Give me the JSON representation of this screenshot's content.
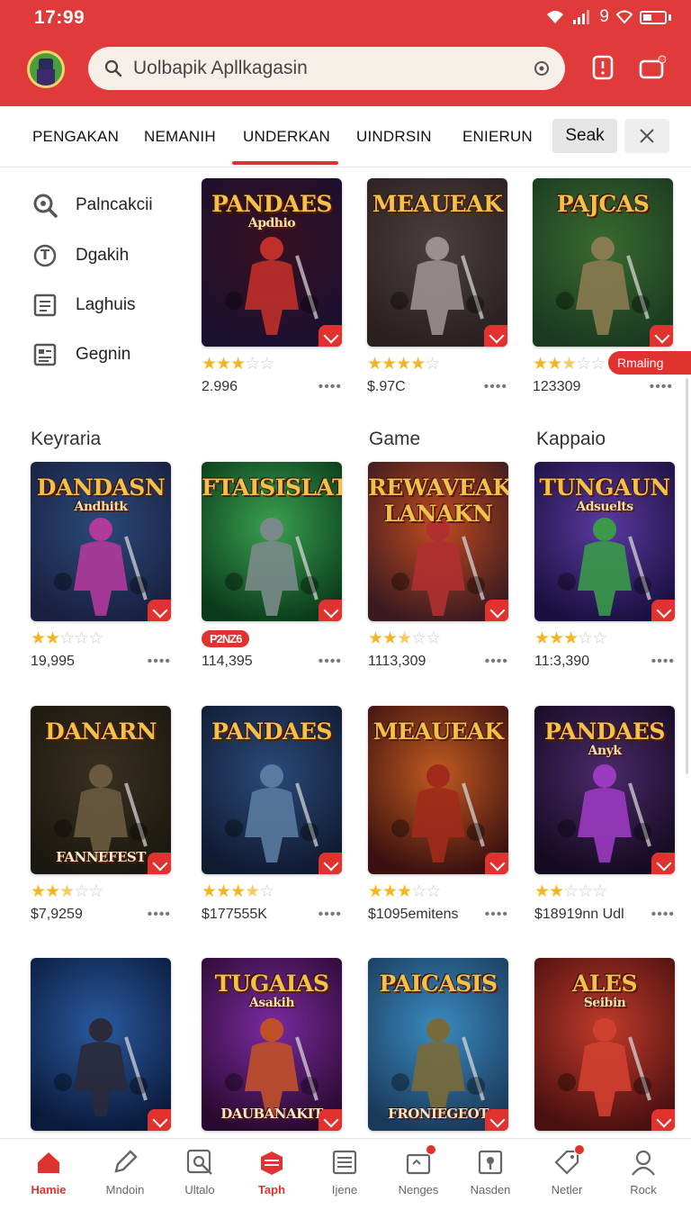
{
  "status": {
    "time": "17:99",
    "battery_text": "9"
  },
  "search": {
    "placeholder": "Uolbapik Apllkagasin"
  },
  "tabs": [
    {
      "label": "PENGAKAN"
    },
    {
      "label": "NEMANIH"
    },
    {
      "label": "UNDERKAN",
      "active": true
    },
    {
      "label": "UINDRSIN"
    },
    {
      "label": "ENIERUN"
    }
  ],
  "actions": {
    "seak_label": "Seak"
  },
  "sidebar": {
    "items": [
      {
        "label": "Palncakcii",
        "icon": "search-icon"
      },
      {
        "label": "Dgakih",
        "icon": "info-icon"
      },
      {
        "label": "Laghuis",
        "icon": "list-icon"
      },
      {
        "label": "Gegnin",
        "icon": "document-icon"
      }
    ]
  },
  "ribbon": {
    "label": "Rmaling"
  },
  "sections": {
    "left": "Keyraria",
    "mid": "Game",
    "right": "Kappaio"
  },
  "games": {
    "row0": [
      {
        "title": "PANDAES",
        "subtitle": "Apdhio",
        "rating": 3,
        "price": "2.996",
        "colors": [
          "#3a1020",
          "#1a1030"
        ],
        "accent": "#c0302a"
      },
      {
        "title": "MEAUEAK",
        "subtitle": "",
        "rating": 4,
        "price": "$.97C",
        "colors": [
          "#4a4040",
          "#2a2020"
        ],
        "accent": "#9a9090"
      },
      {
        "title": "PAJCAS",
        "subtitle": "",
        "rating": 2.5,
        "price": "123309",
        "colors": [
          "#3a6a30",
          "#1a3a20"
        ],
        "accent": "#8a7a50"
      }
    ],
    "row1": [
      {
        "title": "DANDASN",
        "subtitle": "Andhitk",
        "rating": 2,
        "price": "19,995",
        "colors": [
          "#2a4a7a",
          "#1a2040"
        ],
        "accent": "#b03a9a"
      },
      {
        "title": "FTAISISLAT",
        "subtitle": "",
        "rating": 0,
        "price": "114,395",
        "badge": "P2NZ6",
        "colors": [
          "#3aa050",
          "#0a3a1a"
        ],
        "accent": "#7a8a8a"
      },
      {
        "title": "REWAVEAK LANAKN",
        "subtitle": "",
        "rating": 2.5,
        "price": "1113,309",
        "colors": [
          "#c04a20",
          "#3a1a20"
        ],
        "accent": "#b03030"
      },
      {
        "title": "TUNGAUN",
        "subtitle": "Adsuelts",
        "rating": 3,
        "price": "11:3,390",
        "colors": [
          "#5a3aa0",
          "#1a1040"
        ],
        "accent": "#3a9a4a"
      }
    ],
    "row2": [
      {
        "title": "DANARN",
        "subtitle": "",
        "footer": "FANNEFEST",
        "rating": 2.5,
        "price": "$7,9259",
        "colors": [
          "#3a3020",
          "#1a1810"
        ],
        "accent": "#6a5a40"
      },
      {
        "title": "PANDAES",
        "subtitle": "",
        "rating": 3.5,
        "price": "$177555K",
        "colors": [
          "#2a4a7a",
          "#101a30"
        ],
        "accent": "#5a7aa0"
      },
      {
        "title": "MEAUEAK",
        "subtitle": "",
        "rating": 3,
        "price": "$1095emitens",
        "colors": [
          "#c05a20",
          "#3a1010"
        ],
        "accent": "#a02a1a"
      },
      {
        "title": "PANDAES",
        "subtitle": "Anyk",
        "rating": 2,
        "price": "$18919nn Udl",
        "colors": [
          "#4a2a6a",
          "#150a20"
        ],
        "accent": "#9a3ac0"
      }
    ],
    "row3": [
      {
        "title": "",
        "subtitle": "",
        "colors": [
          "#2a5aa0",
          "#0a1a3a"
        ],
        "accent": "#2a2a3a"
      },
      {
        "title": "TUGAIAS",
        "subtitle": "Asakih",
        "footer": "DAUBANAKIT",
        "colors": [
          "#7a2aa0",
          "#2a0a30"
        ],
        "accent": "#c0502a"
      },
      {
        "title": "PAICASIS",
        "subtitle": "",
        "footer": "FRONIEGEOT",
        "colors": [
          "#3a8ac0",
          "#1a3a5a"
        ],
        "accent": "#7a6a3a"
      },
      {
        "title": "ALES",
        "subtitle": "Seibin",
        "colors": [
          "#c03a2a",
          "#4a1010"
        ],
        "accent": "#d04030"
      }
    ]
  },
  "bottom_nav": [
    {
      "label": "Hamie",
      "icon": "home-icon",
      "active": true
    },
    {
      "label": "Mndoin",
      "icon": "pencil-icon"
    },
    {
      "label": "Ultalo",
      "icon": "search-box-icon"
    },
    {
      "label": "Taph",
      "icon": "layers-icon",
      "highlight": true
    },
    {
      "label": "Ijene",
      "icon": "list-icon"
    },
    {
      "label": "Nenges",
      "icon": "gift-icon",
      "notification": true
    },
    {
      "label": "Nasden",
      "icon": "card-icon"
    },
    {
      "label": "Netler",
      "icon": "tag-icon",
      "notification": true
    },
    {
      "label": "Rock",
      "icon": "person-icon"
    }
  ],
  "theme": {
    "primary": "#e03a3a",
    "star": "#f5b522"
  }
}
